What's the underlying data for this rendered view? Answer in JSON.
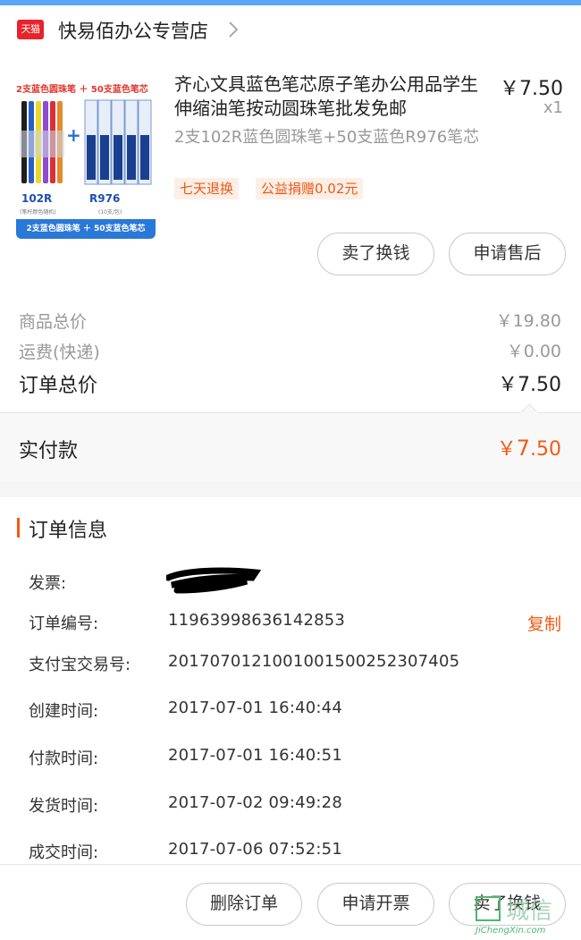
{
  "store": {
    "logo_text": "天猫",
    "name": "快易佰办公专营店"
  },
  "product": {
    "thumbnail": {
      "title": "2支蓝色圆珠笔 ＋ 50支蓝色笔芯",
      "label_left": "102R",
      "sub_left": "(笔杆颜色随机)",
      "label_right": "R976",
      "sub_right": "(10支/包)",
      "banner": "2支蓝色圆珠笔 ＋ 50支蓝色笔芯"
    },
    "title": "齐心文具蓝色笔芯原子笔办公用品学生伸缩油笔按动圆珠笔批发免邮",
    "sku": "2支102R蓝色圆珠笔+50支蓝色R976笔芯",
    "price": "￥7.50",
    "qty": "x1",
    "tags": [
      "七天退换",
      "公益捐赠0.02元"
    ],
    "buttons": {
      "sell": "卖了换钱",
      "aftersale": "申请售后"
    }
  },
  "summary": {
    "goods_total_label": "商品总价",
    "goods_total_value": "￥19.80",
    "shipping_label": "运费(快递)",
    "shipping_value": "￥0.00",
    "order_total_label": "订单总价",
    "order_total_value": "￥7.50",
    "paid_label": "实付款",
    "paid_currency": "￥",
    "paid_int": "7",
    "paid_dec": ".50"
  },
  "order_info": {
    "title": "订单信息",
    "rows": [
      {
        "key": "发票:",
        "value": ""
      },
      {
        "key": "订单编号:",
        "value": "11963998636142853"
      },
      {
        "key": "支付宝交易号:",
        "value": "2017070121001001500252307405"
      },
      {
        "key": "创建时间:",
        "value": "2017-07-01 16:40:44"
      },
      {
        "key": "付款时间:",
        "value": "2017-07-01 16:40:51"
      },
      {
        "key": "发货时间:",
        "value": "2017-07-02 09:49:28"
      },
      {
        "key": "成交时间:",
        "value": "2017-07-06 07:52:51"
      }
    ],
    "copy_label": "复制"
  },
  "bottom_bar": {
    "delete": "删除订单",
    "invoice": "申请开票",
    "sell": "卖了换钱"
  },
  "watermark": {
    "text": "城信",
    "url": "JiChengXin.com"
  },
  "colors": {
    "accent": "#f25a13",
    "tmall_red": "#e8232c",
    "top_bar": "#5aa6f5"
  }
}
